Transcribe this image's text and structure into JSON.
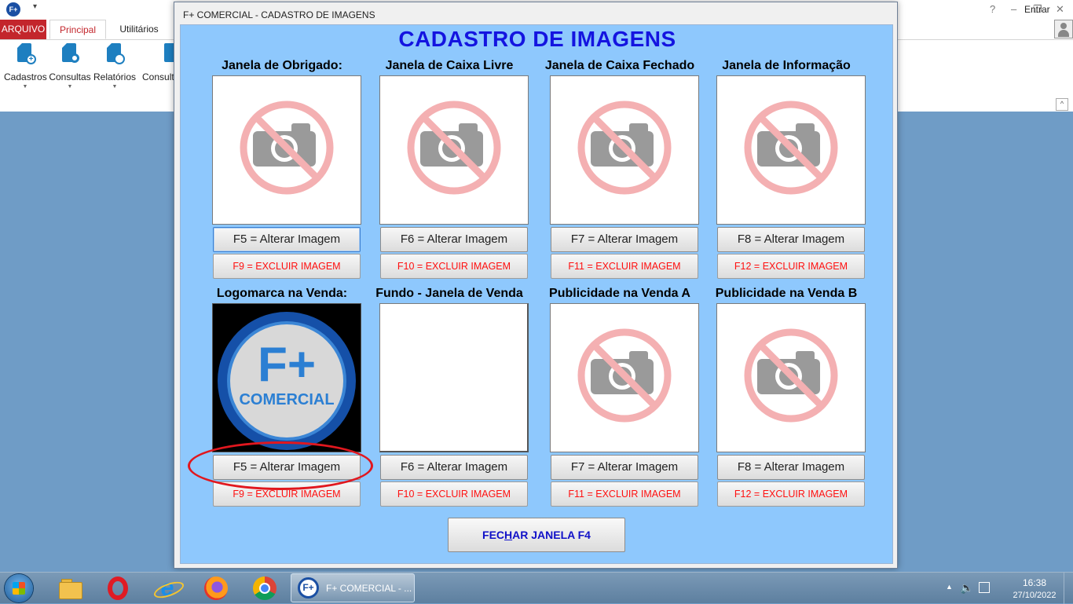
{
  "app": {
    "title_icon_text": "F+",
    "tabs": {
      "arquivo": "ARQUIVO",
      "principal": "Principal",
      "utilitarios": "Utilitários"
    },
    "login": "Entrar",
    "window_controls": {
      "help": "?",
      "minimize": "–",
      "restore": "❐",
      "close": "✕"
    },
    "ribbon": [
      {
        "label": "Cadastros",
        "icon": "document-add-icon"
      },
      {
        "label": "Consultas",
        "icon": "document-search-icon"
      },
      {
        "label": "Relatórios",
        "icon": "document-report-icon"
      },
      {
        "label": "Consult",
        "icon": "document-icon"
      }
    ],
    "accent_color": "#c3262c"
  },
  "dialog": {
    "title": "F+ COMERCIAL - CADASTRO DE IMAGENS",
    "heading": "CADASTRO DE IMAGENS",
    "background_color": "#8ec8fd",
    "cells": [
      {
        "label": "Janela de Obrigado:",
        "image": "no-image-placeholder",
        "alter": "F5 = Alterar Imagem",
        "delete": "F9 = EXCLUIR IMAGEM",
        "focused": true
      },
      {
        "label": "Janela de Caixa Livre",
        "image": "no-image-placeholder",
        "alter": "F6 = Alterar Imagem",
        "delete": "F10 = EXCLUIR IMAGEM"
      },
      {
        "label": "Janela de Caixa Fechado",
        "image": "no-image-placeholder",
        "alter": "F7 = Alterar Imagem",
        "delete": "F11 = EXCLUIR IMAGEM"
      },
      {
        "label": "Janela de Informação",
        "image": "no-image-placeholder",
        "alter": "F8 = Alterar Imagem",
        "delete": "F12 = EXCLUIR IMAGEM"
      },
      {
        "label": "Logomarca na Venda:",
        "image": "fcomercial-logo",
        "logo_top": "F+",
        "logo_bottom": "COMERCIAL",
        "alter": "F5 = Alterar Imagem",
        "delete": "F9 = EXCLUIR IMAGEM"
      },
      {
        "label": "Fundo - Janela de Venda",
        "image": "blank",
        "alter": "F6 = Alterar Imagem",
        "delete": "F10 = EXCLUIR IMAGEM"
      },
      {
        "label": "Publicidade na Venda A",
        "image": "no-image-placeholder",
        "alter": "F7 = Alterar Imagem",
        "delete": "F11 = EXCLUIR IMAGEM"
      },
      {
        "label": "Publicidade na Venda B",
        "image": "no-image-placeholder",
        "alter": "F8 = Alterar Imagem",
        "delete": "F12 = EXCLUIR IMAGEM"
      }
    ],
    "close_button": {
      "before": "FEC",
      "mnemonic": "H",
      "after": "AR JANELA F4"
    }
  },
  "taskbar": {
    "pinned": [
      "windows-start-icon",
      "file-explorer-icon",
      "opera-icon",
      "internet-explorer-icon",
      "firefox-icon",
      "chrome-icon"
    ],
    "active_app": {
      "icon_text": "F+",
      "label": "F+ COMERCIAL - ..."
    },
    "clock": {
      "time": "16:38",
      "date": "27/10/2022"
    }
  }
}
